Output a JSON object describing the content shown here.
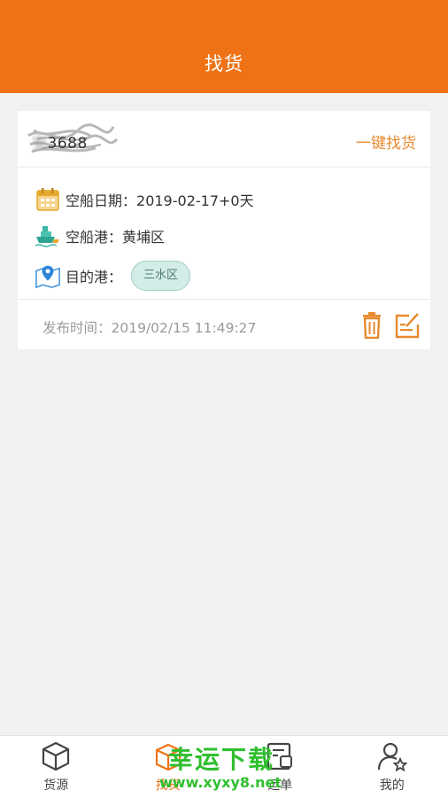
{
  "colors": {
    "brand": "#ef7316",
    "accent": "#e68a2e",
    "tag_bg": "#d4ece8",
    "watermark": "#2fbf2f"
  },
  "header": {
    "title": "找货"
  },
  "card": {
    "name_masked": "安",
    "name_suffix": "3688",
    "one_key_label": "一键找货",
    "date_label": "空船日期：",
    "date_value": "2019-02-17+0天",
    "port_label": "空船港：",
    "port_value": "黄埔区",
    "dest_label": "目的港：",
    "dest_tags": [
      "三水区"
    ],
    "publish_label": "发布时间：",
    "publish_value": "2019/02/15 11:49:27",
    "icons": {
      "date": "calendar-icon",
      "port": "ship-icon",
      "dest": "map-pin-icon",
      "delete": "trash-icon",
      "edit": "edit-icon"
    }
  },
  "tabbar": {
    "items": [
      {
        "label": "货源",
        "icon": "cube-icon"
      },
      {
        "label": "找货",
        "icon": "box-icon"
      },
      {
        "label": "运单",
        "icon": "waybill-icon"
      },
      {
        "label": "我的",
        "icon": "user-icon"
      }
    ]
  },
  "watermark": {
    "text": "幸运下载",
    "url": "www.xyxy8.net"
  }
}
